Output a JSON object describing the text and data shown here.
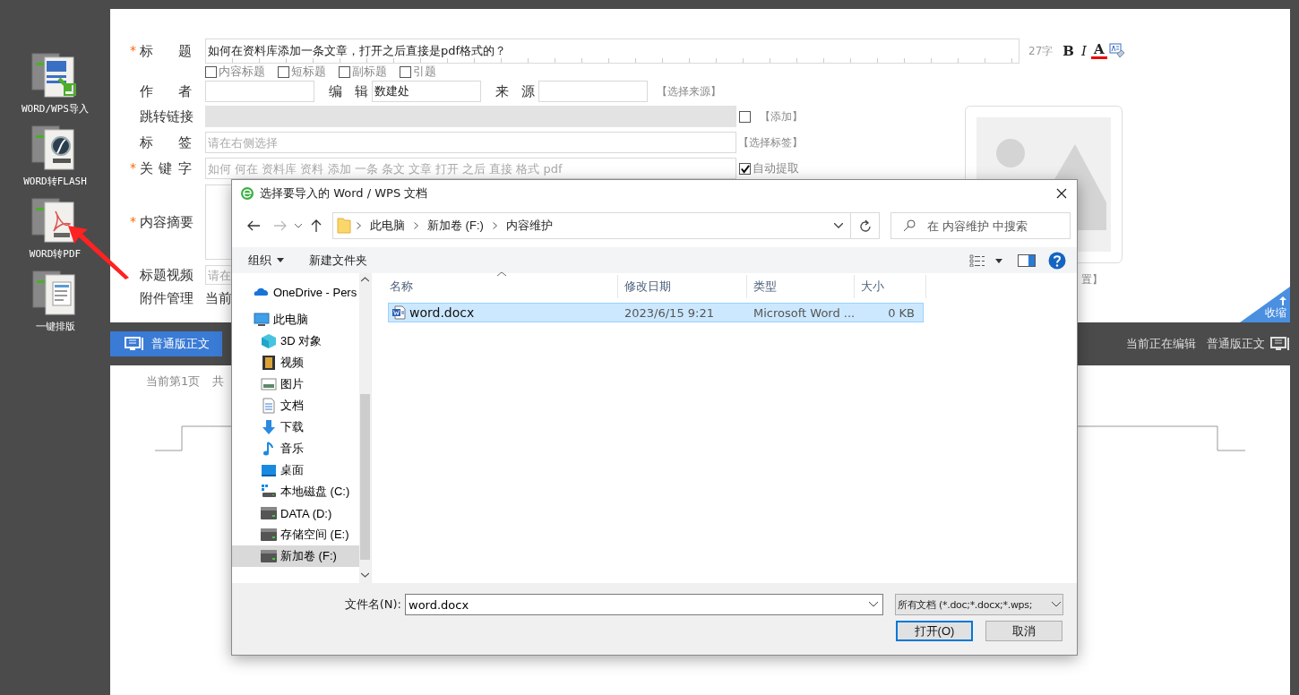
{
  "tools": [
    {
      "kind": "import",
      "label": "WORD/WPS导入"
    },
    {
      "kind": "flash",
      "label": "WORD转FLASH"
    },
    {
      "kind": "pdf",
      "label": "WORD转PDF"
    },
    {
      "kind": "layout",
      "label": "一键排版"
    }
  ],
  "form": {
    "title": {
      "mark": "*",
      "label": "标 题",
      "value": "如何在资料库添加一条文章，打开之后直接是pdf格式的？",
      "count": "27字",
      "format": [
        {
          "kind": "bold",
          "label": "B"
        },
        {
          "kind": "italic",
          "label": "I"
        },
        {
          "kind": "color",
          "label": "A"
        },
        {
          "kind": "spell"
        }
      ]
    },
    "title_options": [
      {
        "label": "内容标题",
        "checked": false
      },
      {
        "label": "短标题",
        "checked": false
      },
      {
        "label": "副标题",
        "checked": false
      },
      {
        "label": "引题",
        "checked": false
      }
    ],
    "author": {
      "label": "作 者"
    },
    "editor": {
      "label": "编 辑",
      "value": "数建处"
    },
    "source": {
      "label": "来 源",
      "link": "【选择来源】"
    },
    "jump": {
      "label": "跳转链接",
      "checked": false,
      "link": "【添加】"
    },
    "tags": {
      "label": "标 签",
      "placeholder": "请在右侧选择",
      "link": "【选择标签】"
    },
    "keywords": {
      "mark": "*",
      "label": "关 键 字",
      "placeholder": "如何 何在 资料库 资料 添加 一条 条文 文章 打开 之后 直接 格式 pdf",
      "auto": {
        "label": "自动提取",
        "checked": true
      }
    },
    "summary": {
      "mark": "*",
      "label": "内容摘要"
    },
    "video": {
      "label": "标题视频",
      "placeholder": "请在"
    },
    "attachments": {
      "label": "附件管理",
      "text": "当前"
    },
    "image_link": "置】",
    "collapse": "收缩"
  },
  "bar": {
    "mode_button": "普通版正文",
    "status": "当前正在编辑",
    "mode": "普通版正文"
  },
  "document": {
    "page": "当前第1页",
    "total": "共"
  },
  "dialog": {
    "title": "选择要导入的 Word / WPS 文档",
    "path": [
      "此电脑",
      "新加卷 (F:)",
      "内容维护"
    ],
    "search_placeholder": "在 内容维护 中搜索",
    "toolbar": [
      {
        "label": "组织",
        "dropdown": true
      },
      {
        "label": "新建文件夹",
        "dropdown": false
      }
    ],
    "nav": [
      {
        "kind": "onedrive",
        "label": "OneDrive - Pers",
        "selected": false
      },
      {
        "kind": "pc",
        "label": "此电脑",
        "selected": false,
        "children": [
          {
            "kind": "cube",
            "label": "3D 对象",
            "selected": false
          },
          {
            "kind": "video",
            "label": "视频",
            "selected": false
          },
          {
            "kind": "pictures",
            "label": "图片",
            "selected": false
          },
          {
            "kind": "documents",
            "label": "文档",
            "selected": false
          },
          {
            "kind": "downloads",
            "label": "下载",
            "selected": false
          },
          {
            "kind": "music",
            "label": "音乐",
            "selected": false
          },
          {
            "kind": "desktop",
            "label": "桌面",
            "selected": false
          },
          {
            "kind": "system-drive",
            "label": "本地磁盘 (C:)",
            "selected": false
          },
          {
            "kind": "drive",
            "label": "DATA (D:)",
            "selected": false
          },
          {
            "kind": "drive",
            "label": "存储空间 (E:)",
            "selected": false
          },
          {
            "kind": "drive",
            "label": "新加卷 (F:)",
            "selected": true
          }
        ]
      }
    ],
    "columns": [
      "名称",
      "修改日期",
      "类型",
      "大小"
    ],
    "files": [
      {
        "name": "word.docx",
        "modified": "2023/6/15 9:21",
        "type": "Microsoft Word ...",
        "size": "0 KB",
        "selected": true
      }
    ],
    "filename_label": "文件名(N):",
    "filename": "word.docx",
    "filter": "所有文档 (*.doc;*.docx;*.wps;",
    "buttons": [
      {
        "label": "打开(O)",
        "primary": true
      },
      {
        "label": "取消",
        "primary": false
      }
    ]
  }
}
